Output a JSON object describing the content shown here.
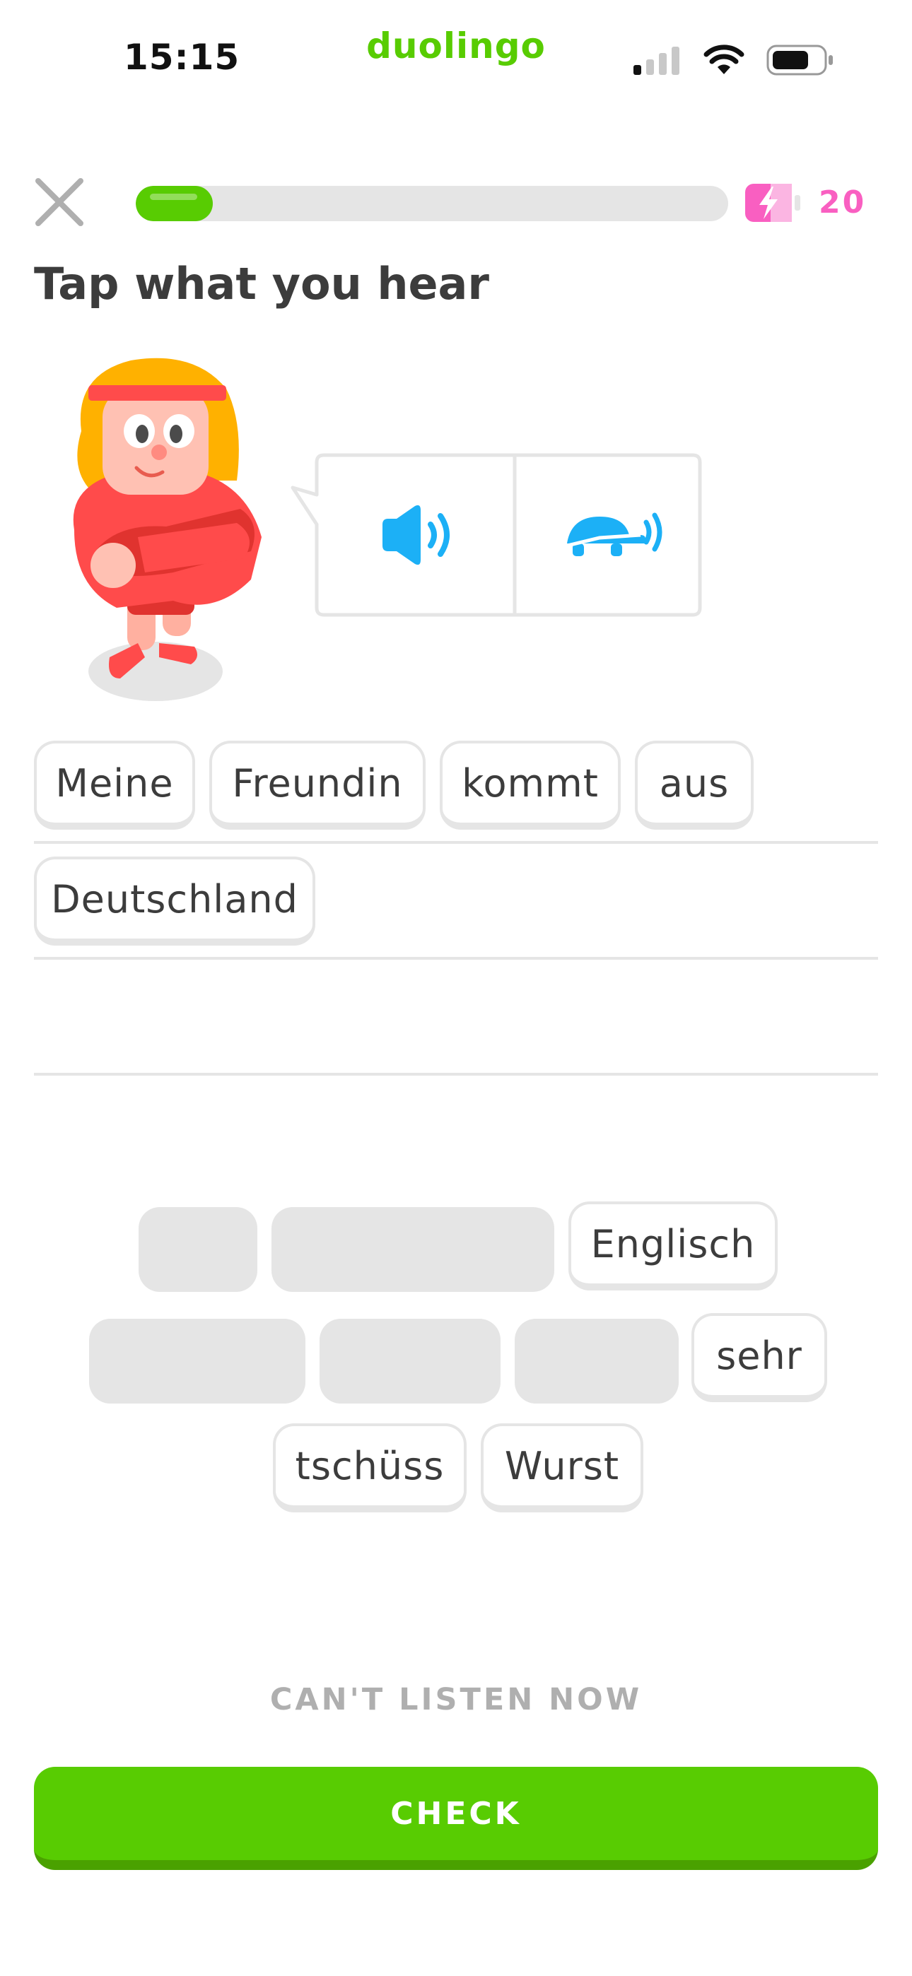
{
  "status_bar": {
    "time": "15:15",
    "icons": [
      "cellular-signal-icon",
      "wifi-icon",
      "battery-icon"
    ]
  },
  "app": {
    "brand": "duolingo",
    "brand_color": "#58cc02"
  },
  "header": {
    "close_icon": "close-icon",
    "progress_fraction": 0.13,
    "energy_icon": "energy-battery-icon",
    "energy_count": "20",
    "energy_color": "#f95fc1"
  },
  "exercise": {
    "prompt": "Tap what you hear",
    "character_icon": "character-icon",
    "audio_buttons": [
      {
        "icon": "speaker-icon"
      },
      {
        "icon": "slow-turtle-speaker-icon"
      }
    ],
    "answer_chips": [
      "Meine",
      "Freundin",
      "kommt",
      "aus",
      "Deutschland"
    ],
    "word_bank": [
      "Englisch",
      "sehr",
      "tschüss",
      "Wurst"
    ]
  },
  "footer": {
    "cant_listen": "CAN'T LISTEN NOW",
    "check": "CHECK"
  },
  "colors": {
    "accent": "#58cc02",
    "audio_blue": "#1cb0f6",
    "chip_border": "#e5e5e5",
    "text": "#3c3c3c"
  }
}
